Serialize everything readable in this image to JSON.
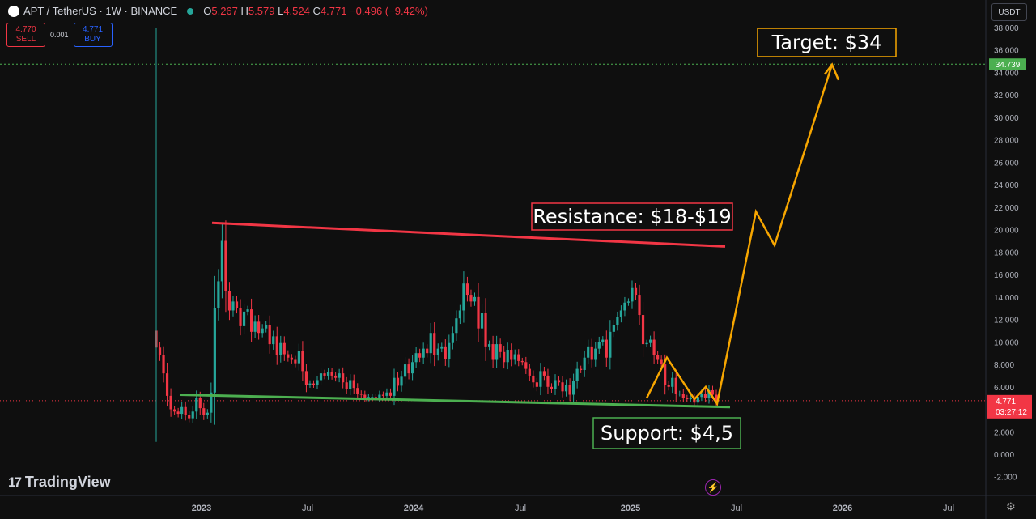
{
  "header": {
    "symbol": "APT / TetherUS · 1W · BINANCE",
    "o_label": "O",
    "o": "5.267",
    "h_label": "H",
    "h": "5.579",
    "l_label": "L",
    "l": "4.524",
    "c_label": "C",
    "c": "4.771",
    "change": "−0.496 (−9.42%)"
  },
  "trade": {
    "sell_price": "4.770",
    "sell_label": "SELL",
    "spread": "0.001",
    "buy_price": "4.771",
    "buy_label": "BUY"
  },
  "currency": "USDT",
  "brand": "TradingView",
  "colors": {
    "up": "#26a69a",
    "down": "#f23645",
    "resistance": "#f23645",
    "support": "#4caf50",
    "projection": "#f7a600",
    "bg": "#0f0f0f"
  },
  "chart_data": {
    "type": "candlestick",
    "y_ticks": [
      -2,
      0,
      2,
      4,
      6,
      8,
      10,
      12,
      14,
      16,
      18,
      20,
      22,
      24,
      26,
      28,
      30,
      32,
      34,
      36,
      38
    ],
    "y_tick_labels": [
      "-2.000",
      "0.000",
      "2.000",
      "4.000",
      "6.000",
      "8.000",
      "10.000",
      "12.000",
      "14.000",
      "16.000",
      "18.000",
      "20.000",
      "22.000",
      "24.000",
      "26.000",
      "28.000",
      "30.000",
      "32.000",
      "34.000",
      "36.000",
      "38.000"
    ],
    "ylim": [
      -2.5,
      39.5
    ],
    "x_ticks": [
      "2023",
      "Jul",
      "2024",
      "Jul",
      "2025",
      "Jul",
      "2026",
      "Jul"
    ],
    "last_price": "4.771",
    "countdown": "03:27:12",
    "target_line_label": "34.739",
    "close_series": [
      9.5,
      8.8,
      7.2,
      5.2,
      4.0,
      3.8,
      3.6,
      4.2,
      3.5,
      3.2,
      3.8,
      5.0,
      4.1,
      3.5,
      3.7,
      5.5,
      13.0,
      15.4,
      19.0,
      14.5,
      12.8,
      13.6,
      13.0,
      11.4,
      12.7,
      12.9,
      10.9,
      11.8,
      10.8,
      11.2,
      11.5,
      9.8,
      10.5,
      8.8,
      9.9,
      8.9,
      8.6,
      8.4,
      8.1,
      9.2,
      7.4,
      6.2,
      6.3,
      6.2,
      6.6,
      7.2,
      7.0,
      7.3,
      7.0,
      6.8,
      7.2,
      6.4,
      5.8,
      6.6,
      5.9,
      5.4,
      5.3,
      5.0,
      5.1,
      5.1,
      5.0,
      5.3,
      5.2,
      5.5,
      5.2,
      6.8,
      6.1,
      6.9,
      8.0,
      7.2,
      8.2,
      9.0,
      8.6,
      9.4,
      9.0,
      10.8,
      8.8,
      9.4,
      9.6,
      8.5,
      9.9,
      10.8,
      12.1,
      12.8,
      15.2,
      14.2,
      13.6,
      14.0,
      11.2,
      12.6,
      9.6,
      9.8,
      8.4,
      9.8,
      9.1,
      8.2,
      9.3,
      8.4,
      8.9,
      8.3,
      8.2,
      7.6,
      7.0,
      6.4,
      6.0,
      7.4,
      7.0,
      6.0,
      5.8,
      6.6,
      6.4,
      5.6,
      6.2,
      5.3,
      6.5,
      7.6,
      7.5,
      8.6,
      9.6,
      8.4,
      9.4,
      10.0,
      10.2,
      8.6,
      10.9,
      11.5,
      12.2,
      12.8,
      13.5,
      13.6,
      14.8,
      14.2,
      12.4,
      9.8,
      9.9,
      10.2,
      8.8,
      8.4,
      8.0,
      6.2,
      6.0,
      6.8,
      5.4,
      5.4,
      5.0,
      4.9,
      5.0,
      4.6,
      5.1,
      5.4,
      5.0,
      5.7,
      5.3,
      4.77
    ],
    "resistance": {
      "label": "Resistance: $18-$19",
      "start": 20.6,
      "end": 18.5
    },
    "support": {
      "label": "Support: $4,5",
      "start": 5.3,
      "end": 4.2
    },
    "target": {
      "label": "Target: $34",
      "value": 34.739
    },
    "projection": [
      5.0,
      8.6,
      4.9,
      6.0,
      4.5,
      21.6,
      18.6,
      34.7
    ]
  }
}
